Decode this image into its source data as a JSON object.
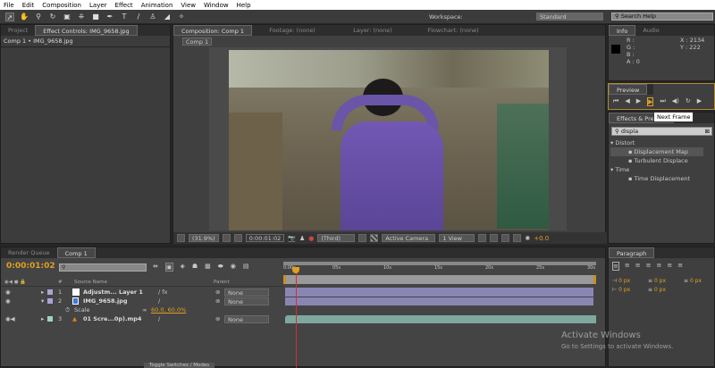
{
  "menu": [
    "File",
    "Edit",
    "Composition",
    "Layer",
    "Effect",
    "Animation",
    "View",
    "Window",
    "Help"
  ],
  "workspace": {
    "label": "Workspace:",
    "value": "Standard"
  },
  "search_help": "Search Help",
  "left_panel": {
    "tabs": [
      "Project",
      "Effect Controls: IMG_9658.jpg"
    ],
    "subtitle": "Comp 1 • IMG_9658.jpg"
  },
  "comp_panel": {
    "tabs": [
      "Composition: Comp 1",
      "Footage: (none)",
      "Layer: (none)",
      "Flowchart: (none)"
    ],
    "breadcrumb": "Comp 1",
    "footer": {
      "zoom": "(31.9%)",
      "timecode": "0:00:01:02",
      "resolution": "(Third)",
      "camera": "Active Camera",
      "views": "1 View",
      "exposure": "+0.0"
    }
  },
  "info": {
    "tabs": [
      "Info",
      "Audio"
    ],
    "r": "R :",
    "g": "G :",
    "b": "B :",
    "a": "A : 0",
    "x": "X : 2134",
    "y": "Y : 222",
    "swatch": "#000000"
  },
  "preview": {
    "tab": "Preview",
    "tooltip": "Next Frame"
  },
  "effects": {
    "tab": "Effects & Presets",
    "search": "displa",
    "groups": [
      {
        "name": "Distort",
        "items": [
          "Displacement Map",
          "Turbulent Displace"
        ]
      },
      {
        "name": "Time",
        "items": [
          "Time Displacement"
        ]
      }
    ]
  },
  "timeline": {
    "tabs": [
      "Render Queue",
      "Comp 1"
    ],
    "timecode": "0:00:01:02",
    "headers": {
      "source": "Source Name",
      "parent": "Parent",
      "num": "#"
    },
    "layers": [
      {
        "num": "1",
        "name": "Adjustm... Layer 1",
        "color": "#a9a4d4",
        "parent": "None"
      },
      {
        "num": "2",
        "name": "IMG_9658.jpg",
        "color": "#a9a4d4",
        "parent": "None"
      },
      {
        "num": "3",
        "name": "01 Scre...0p).mp4",
        "color": "#9fd4c4",
        "parent": "None"
      }
    ],
    "scale": {
      "label": "Scale",
      "value": "60.0, 60.0%"
    },
    "ruler": [
      "0:00s",
      "05s",
      "10s",
      "15s",
      "20s",
      "25s",
      "30s"
    ],
    "toggle": "Toggle Switches / Modes"
  },
  "paragraph": {
    "tab": "Paragraph",
    "values": [
      "0 px",
      "0 px",
      "0 px",
      "0 px",
      "0 px"
    ]
  },
  "watermark": {
    "title": "Activate Windows",
    "sub": "Go to Settings to activate Windows."
  },
  "colors": {
    "accent": "#e0a020",
    "timecode": "#e0a020",
    "playhead": "#d03030"
  }
}
